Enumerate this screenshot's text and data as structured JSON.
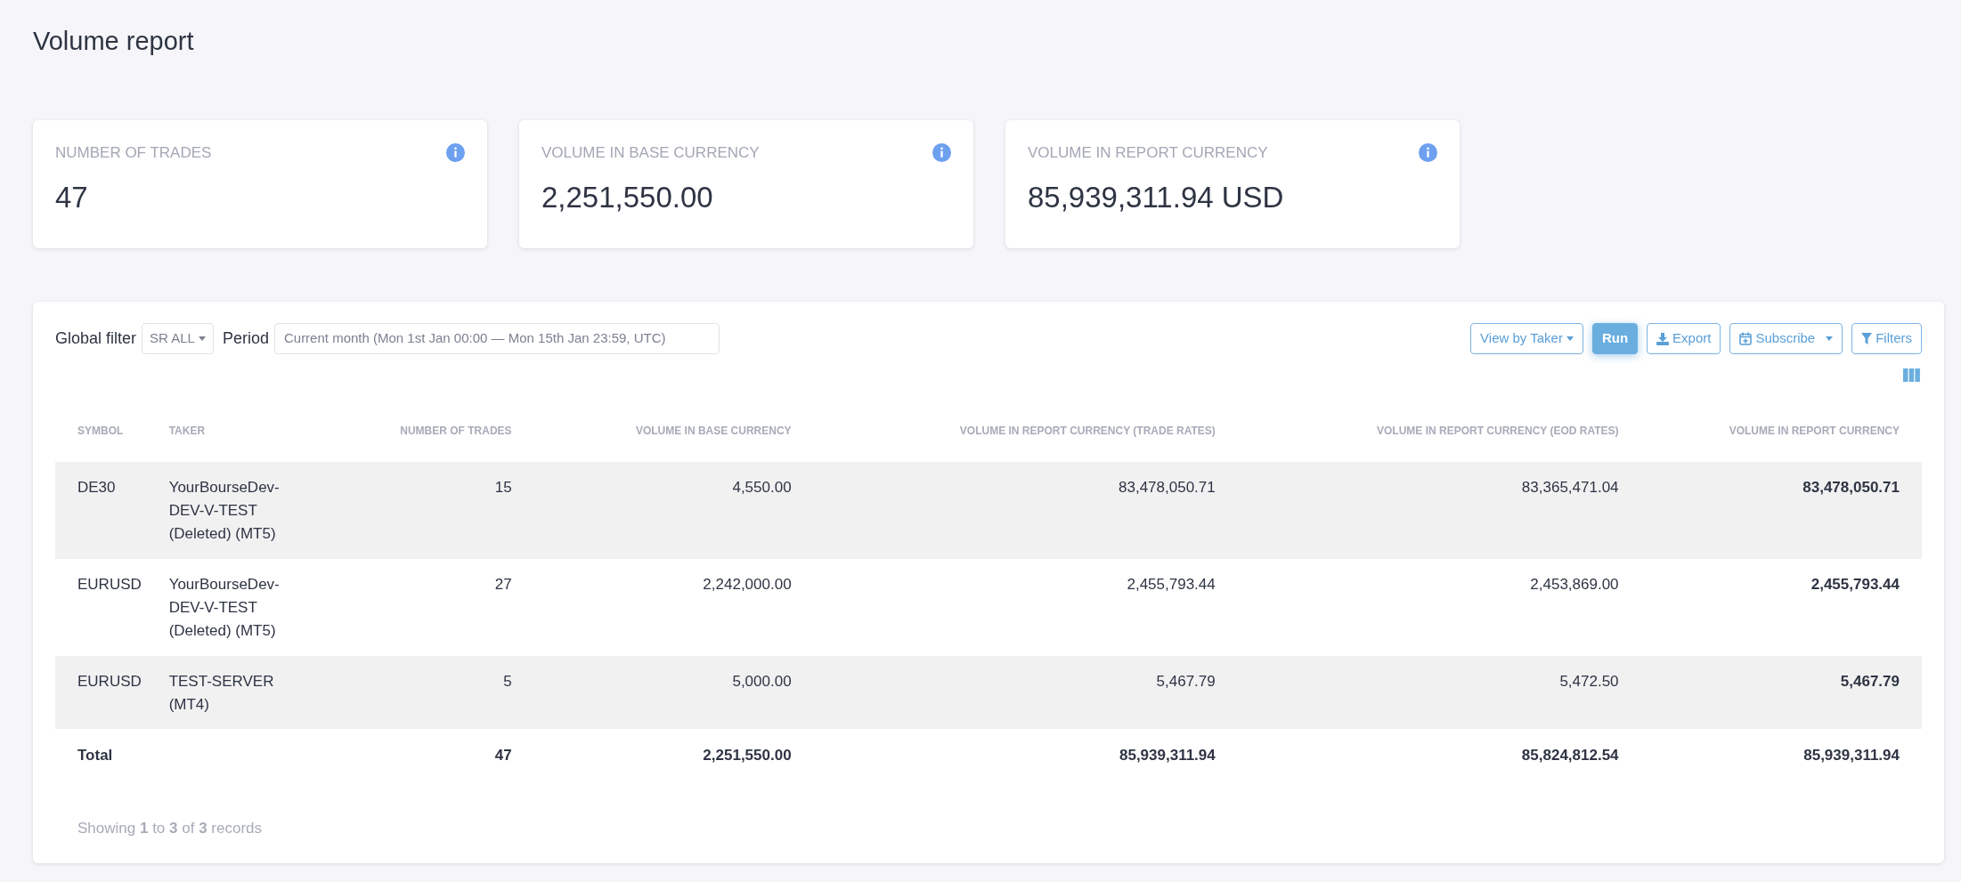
{
  "page_title": "Volume report",
  "stats": [
    {
      "label": "NUMBER OF TRADES",
      "value": "47"
    },
    {
      "label": "VOLUME IN BASE CURRENCY",
      "value": "2,251,550.00"
    },
    {
      "label": "VOLUME IN REPORT CURRENCY",
      "value": "85,939,311.94 USD"
    }
  ],
  "filters": {
    "global_filter_label": "Global filter",
    "global_filter_value": "SR ALL",
    "period_label": "Period",
    "period_value": "Current month (Mon 1st Jan 00:00 — Mon 15th Jan 23:59, UTC)"
  },
  "buttons": [
    {
      "label": "View by Taker",
      "kind": "dropdown"
    },
    {
      "label": "Run",
      "kind": "primary"
    },
    {
      "label": "Export",
      "kind": "export"
    },
    {
      "label": "Subscribe",
      "kind": "subscribe"
    },
    {
      "label": "Filters",
      "kind": "filter"
    }
  ],
  "table": {
    "columns": [
      "SYMBOL",
      "TAKER",
      "NUMBER OF TRADES",
      "VOLUME IN BASE CURRENCY",
      "VOLUME IN REPORT CURRENCY (TRADE RATES)",
      "VOLUME IN REPORT CURRENCY (EOD RATES)",
      "VOLUME IN REPORT CURRENCY"
    ],
    "rows": [
      [
        "DE30",
        "YourBourseDev-DEV-V-TEST (Deleted) (MT5)",
        "15",
        "4,550.00",
        "83,478,050.71",
        "83,365,471.04",
        "83,478,050.71"
      ],
      [
        "EURUSD",
        "YourBourseDev-DEV-V-TEST (Deleted) (MT5)",
        "27",
        "2,242,000.00",
        "2,455,793.44",
        "2,453,869.00",
        "2,455,793.44"
      ],
      [
        "EURUSD",
        "TEST-SERVER (MT4)",
        "5",
        "5,000.00",
        "5,467.79",
        "5,472.50",
        "5,467.79"
      ]
    ],
    "total": {
      "label": "Total",
      "values": [
        "47",
        "2,251,550.00",
        "85,939,311.94",
        "85,824,812.54",
        "85,939,311.94"
      ]
    }
  },
  "footer": "Showing **1** to **3** of **3** records"
}
